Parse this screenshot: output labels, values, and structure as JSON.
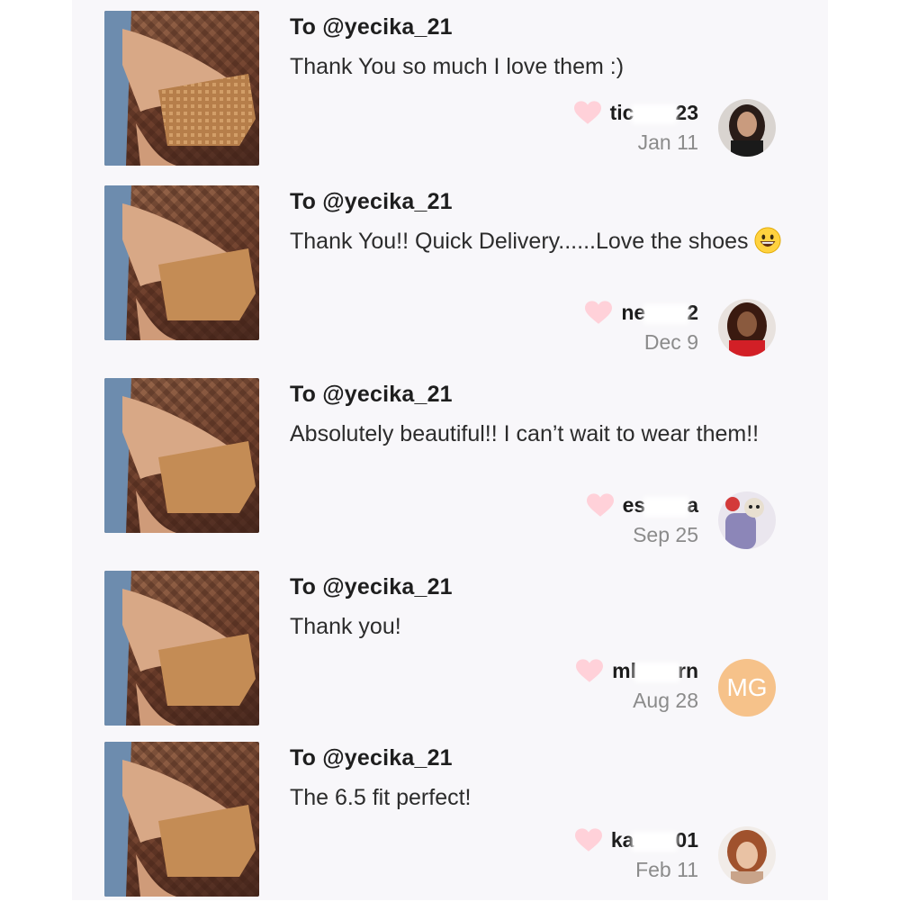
{
  "reviews": [
    {
      "to": "To @yecika_21",
      "message": "Thank You so much I love them :)",
      "user_start": "tic",
      "user_end": "23",
      "date": "Jan 11",
      "avatar_icon": "avatar-photo"
    },
    {
      "to": "To @yecika_21",
      "message": "Thank You!! Quick Delivery......Love the shoes",
      "user_start": "ne",
      "user_end": "2",
      "date": "Dec 9",
      "avatar_icon": "avatar-photo"
    },
    {
      "to": "To @yecika_21",
      "message": "Absolutely beautiful!! I can’t wait to wear them!!",
      "user_start": "es",
      "user_end": "a",
      "date": "Sep 25",
      "avatar_icon": "avatar-photo"
    },
    {
      "to": "To @yecika_21",
      "message": "Thank you!",
      "user_start": "ml",
      "user_end": "rn",
      "date": "Aug 28",
      "avatar_initials": "MG"
    },
    {
      "to": "To @yecika_21",
      "message": "The 6.5 fit perfect!",
      "user_start": "ka",
      "user_end": "01",
      "date": "Feb 11",
      "avatar_icon": "avatar-photo"
    }
  ],
  "colors": {
    "heart": "#ffd1d9",
    "avatar_initials_bg": "#f6c28a",
    "page_bg": "#f8f7fa"
  },
  "icons": [
    "heart-icon",
    "smile-emoji-icon",
    "product-thumbnail"
  ]
}
